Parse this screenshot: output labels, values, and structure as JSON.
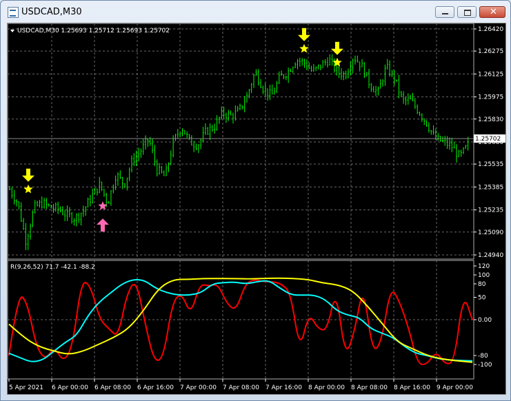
{
  "window": {
    "title": "USDCAD,M30",
    "icon": "chart-window-icon",
    "buttons": {
      "minimize": "minimize-icon",
      "maximize": "maximize-icon",
      "close": "close-icon"
    }
  },
  "chart_header": {
    "label": "USDCAD,M30  1.25693 1.25712 1.25693 1.25702",
    "menu_icon": "triangle-down-icon"
  },
  "indicator_header": {
    "label": "R(9,26,52) 71.7 -42.1 -88.2"
  },
  "colors": {
    "background": "#000000",
    "grid": "#6a6a6a",
    "candles": "#00ff00",
    "signal_star_sell": "#ffff00",
    "signal_arrow_sell": "#ffff00",
    "signal_star_buy": "#ff69b4",
    "signal_arrow_buy": "#ff69b4",
    "line_fast": "#ff0000",
    "line_mid": "#00ffff",
    "line_slow": "#ffff00",
    "text": "#ffffff"
  },
  "chart_data": [
    {
      "type": "candlestick",
      "title": "USDCAD,M30",
      "ylim": [
        1.2494,
        1.2642
      ],
      "y_ticks": [
        "1.26420",
        "1.26275",
        "1.26125",
        "1.25975",
        "1.25830",
        "1.25680",
        "1.25535",
        "1.25385",
        "1.25235",
        "1.25090",
        "1.24940"
      ],
      "current_price": "1.25702",
      "x_ticks": [
        "5 Apr 2021",
        "6 Apr 00:00",
        "6 Apr 08:00",
        "6 Apr 16:00",
        "7 Apr 00:00",
        "7 Apr 08:00",
        "7 Apr 16:00",
        "8 Apr 00:00",
        "8 Apr 08:00",
        "8 Apr 16:00",
        "9 Apr 00:00"
      ],
      "close_path": [
        1.2537,
        1.2528,
        1.2503,
        1.2525,
        1.2528,
        1.2525,
        1.2524,
        1.252,
        1.2518,
        1.2523,
        1.2532,
        1.254,
        1.2528,
        1.2547,
        1.254,
        1.2556,
        1.2562,
        1.257,
        1.255,
        1.2545,
        1.2568,
        1.2578,
        1.2568,
        1.2566,
        1.2575,
        1.2578,
        1.2587,
        1.2585,
        1.2588,
        1.2598,
        1.2614,
        1.2603,
        1.2598,
        1.261,
        1.2614,
        1.2622,
        1.262,
        1.2614,
        1.2618,
        1.2622,
        1.2614,
        1.2612,
        1.2624,
        1.2618,
        1.2606,
        1.26,
        1.2617,
        1.261,
        1.2595,
        1.2595,
        1.2588,
        1.258,
        1.257,
        1.2568,
        1.2565,
        1.2558,
        1.2566
      ],
      "signals": [
        {
          "kind": "sell",
          "x_time": "5 Apr 2021 ~02:00",
          "price": 1.2537
        },
        {
          "kind": "buy",
          "x_time": "6 Apr 08:00",
          "price": 1.2526
        },
        {
          "kind": "sell",
          "x_time": "7 Apr 16:00",
          "price": 1.2629
        },
        {
          "kind": "sell",
          "x_time": "8 Apr 00:00",
          "price": 1.262
        }
      ]
    },
    {
      "type": "line",
      "title": "R(9,26,52)",
      "ylim": [
        -120,
        120
      ],
      "y_ticks": [
        "120",
        "100",
        "80",
        "50",
        "0.00",
        "-80",
        "-100"
      ],
      "series": [
        {
          "name": "9",
          "color": "#ff0000",
          "values": [
            -80,
            60,
            40,
            -60,
            -90,
            -60,
            -95,
            -60,
            90,
            75,
            0,
            -20,
            -40,
            60,
            90,
            -10,
            -95,
            -85,
            40,
            60,
            10,
            80,
            75,
            80,
            35,
            20,
            80,
            90,
            85,
            85,
            80,
            60,
            -70,
            15,
            -20,
            -25,
            70,
            -85,
            -30,
            80,
            -75,
            -50,
            75,
            40,
            -20,
            -100,
            -100,
            -70,
            -100,
            -95,
            60,
            0
          ]
        },
        {
          "name": "26",
          "color": "#00ffff",
          "values": [
            -75,
            -85,
            -95,
            -90,
            -70,
            -50,
            -35,
            10,
            40,
            60,
            80,
            90,
            88,
            70,
            60,
            55,
            55,
            60,
            80,
            83,
            84,
            80,
            85,
            88,
            70,
            55,
            55,
            55,
            45,
            20,
            10,
            5,
            -20,
            -30,
            -40,
            -60,
            -75,
            -80,
            -87,
            -90,
            -91,
            -92
          ]
        },
        {
          "name": "52",
          "color": "#ffff00",
          "values": [
            -10,
            -40,
            -60,
            -70,
            -78,
            -70,
            -55,
            -40,
            -20,
            20,
            70,
            90,
            90,
            92,
            92,
            92,
            91,
            92,
            93,
            92,
            90,
            82,
            78,
            65,
            30,
            -10,
            -50,
            -65,
            -80,
            -88,
            -92,
            -95
          ]
        }
      ]
    }
  ]
}
